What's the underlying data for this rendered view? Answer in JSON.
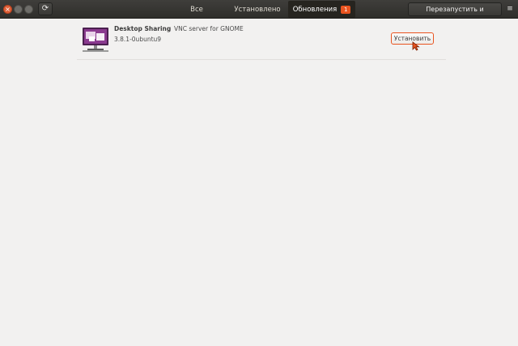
{
  "window": {
    "close_symbol": "×",
    "refresh_symbol": "⟳",
    "menu_symbol": "≡"
  },
  "tabs": [
    {
      "label": "Все",
      "selected": false
    },
    {
      "label": "Установлено",
      "selected": false
    },
    {
      "label": "Обновления",
      "selected": true,
      "badge": "1"
    }
  ],
  "header": {
    "restart_install_label": "Перезапустить и установить"
  },
  "updates": [
    {
      "name": "Desktop Sharing",
      "summary": "VNC server for GNOME",
      "version": "3.8.1-0ubuntu9",
      "install_label": "Установить",
      "icon": "desktop-sharing-icon"
    }
  ],
  "colors": {
    "accent": "#e95420",
    "headerbar": "#3a3936",
    "background": "#f2f1f0"
  }
}
